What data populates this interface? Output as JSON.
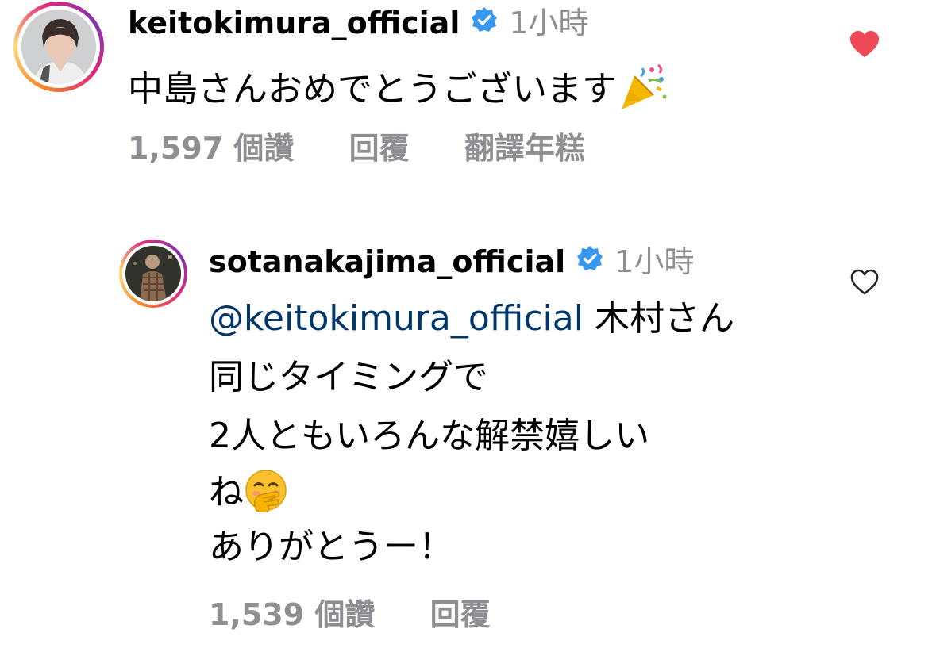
{
  "comment": {
    "username": "keitokimura_official",
    "time": "1小時",
    "text": "中島さんおめでとうございます",
    "text_emoji": "party-popper",
    "likes": "1,597 個讚",
    "reply_label": "回覆",
    "translate_label": "翻譯年糕",
    "liked": true,
    "heart_color": "#ed4956"
  },
  "reply": {
    "username": "sotanakajima_official",
    "time": "1小時",
    "mention": "@keitokimura_official",
    "line1_rest": " 木村さん",
    "line2": "同じタイミングで",
    "line3": "2人ともいろんな解禁嬉しい",
    "line4": "ね",
    "line4_emoji": "face-with-hand-over-mouth",
    "line5": "ありがとうー！",
    "likes": "1,539 個讚",
    "reply_label": "回覆",
    "liked": false
  },
  "colors": {
    "verified_badge": "#3897f0",
    "secondary_text": "#8e8e93",
    "mention": "#00376b"
  }
}
